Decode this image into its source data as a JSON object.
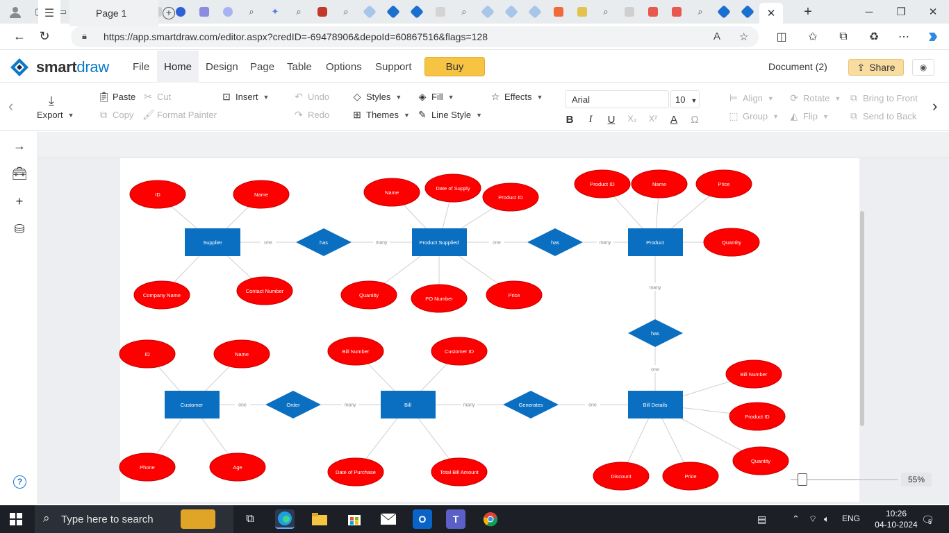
{
  "browser": {
    "url": "https://app.smartdraw.com/editor.aspx?credID=-69478906&depoId=60867516&flags=128",
    "window_controls": {
      "minimize": "─",
      "maximize": "❐",
      "close": "✕"
    },
    "new_tab": "+",
    "active_tab_close": "✕"
  },
  "app": {
    "logo_bold": "smart",
    "logo_light": "draw",
    "menu": [
      {
        "label": "File"
      },
      {
        "label": "Home"
      },
      {
        "label": "Design"
      },
      {
        "label": "Page"
      },
      {
        "label": "Table"
      },
      {
        "label": "Options"
      },
      {
        "label": "Support"
      }
    ],
    "active_menu": "Home",
    "buy_label": "Buy",
    "document_title": "Document (2)",
    "share_label": "Share"
  },
  "ribbon": {
    "export": "Export",
    "paste": "Paste",
    "cut": "Cut",
    "copy": "Copy",
    "format_painter": "Format Painter",
    "insert": "Insert",
    "undo": "Undo",
    "redo": "Redo",
    "styles": "Styles",
    "themes": "Themes",
    "fill": "Fill",
    "line_style": "Line Style",
    "effects": "Effects",
    "font_name": "Arial",
    "font_size": "10",
    "bold": "B",
    "italic": "I",
    "underline": "U",
    "align": "Align",
    "group": "Group",
    "rotate": "Rotate",
    "flip": "Flip",
    "bring_to_front": "Bring to Front",
    "send_to_back": "Send to Back"
  },
  "pages": {
    "tabs": [
      "Page 1"
    ]
  },
  "zoom": "55%",
  "diagram": {
    "colors": {
      "entity": "#0b6fc1",
      "attribute": "#ff0000",
      "relationship": "#0b6fc1",
      "line": "#cfcfcf"
    },
    "entities": [
      "Supplier",
      "Product Supplied",
      "Product",
      "Customer",
      "Bill",
      "Bill Details"
    ],
    "relationships": [
      "has",
      "has",
      "has",
      "Order",
      "Generates"
    ],
    "attributes": {
      "supplier": [
        "ID",
        "Name",
        "Company Name",
        "Contact Number"
      ],
      "product_supplied": [
        "Name",
        "Date of Supply",
        "Product ID",
        "Quantity",
        "PO Number",
        "Price"
      ],
      "product": [
        "Product ID",
        "Name",
        "Price",
        "Quantity"
      ],
      "customer": [
        "ID",
        "Name",
        "Phone",
        "Age"
      ],
      "bill": [
        "Bill Number",
        "Customer ID",
        "Date of Purchase",
        "Total Bill Amount"
      ],
      "bill_details": [
        "Bill Number",
        "Product ID",
        "Quantity",
        "Discount",
        "Price"
      ]
    },
    "cardinality": [
      "one",
      "many",
      "one",
      "many",
      "many",
      "one",
      "one",
      "many",
      "many",
      "one"
    ]
  },
  "taskbar": {
    "search_placeholder": "Type here to search",
    "language": "ENG",
    "time": "10:26",
    "date": "04-10-2024",
    "notifications": "5"
  }
}
